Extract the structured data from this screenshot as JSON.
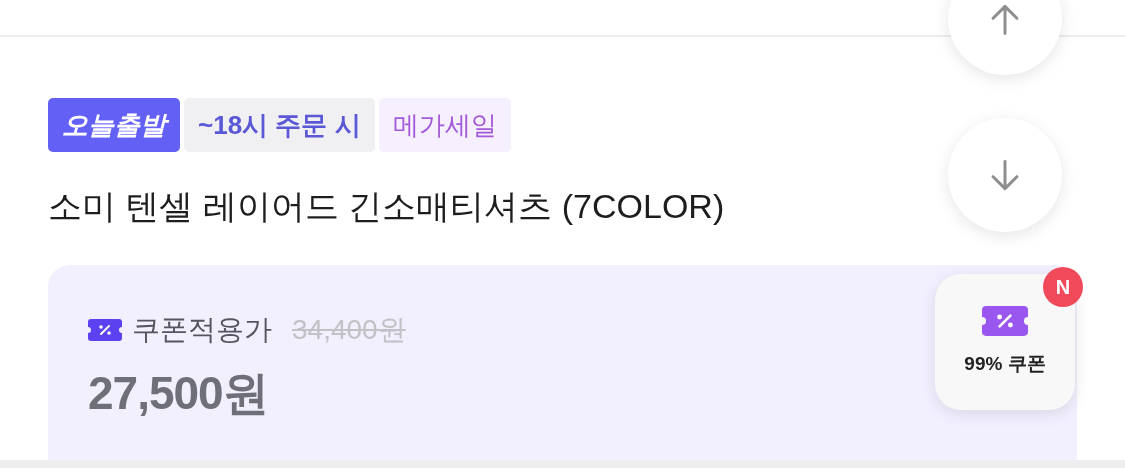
{
  "tags": [
    {
      "kind": "delivery",
      "label": "오늘출발"
    },
    {
      "kind": "cutoff",
      "label": "~18시 주문 시"
    },
    {
      "kind": "sale",
      "label": "메가세일"
    }
  ],
  "title": "소미 텐셀 레이어드 긴소매티셔츠 (7COLOR)",
  "price": {
    "label": "쿠폰적용가",
    "original": "34,400원",
    "final": "27,500원"
  },
  "coupon_widget": {
    "label": "99% 쿠폰",
    "badge": "N"
  }
}
